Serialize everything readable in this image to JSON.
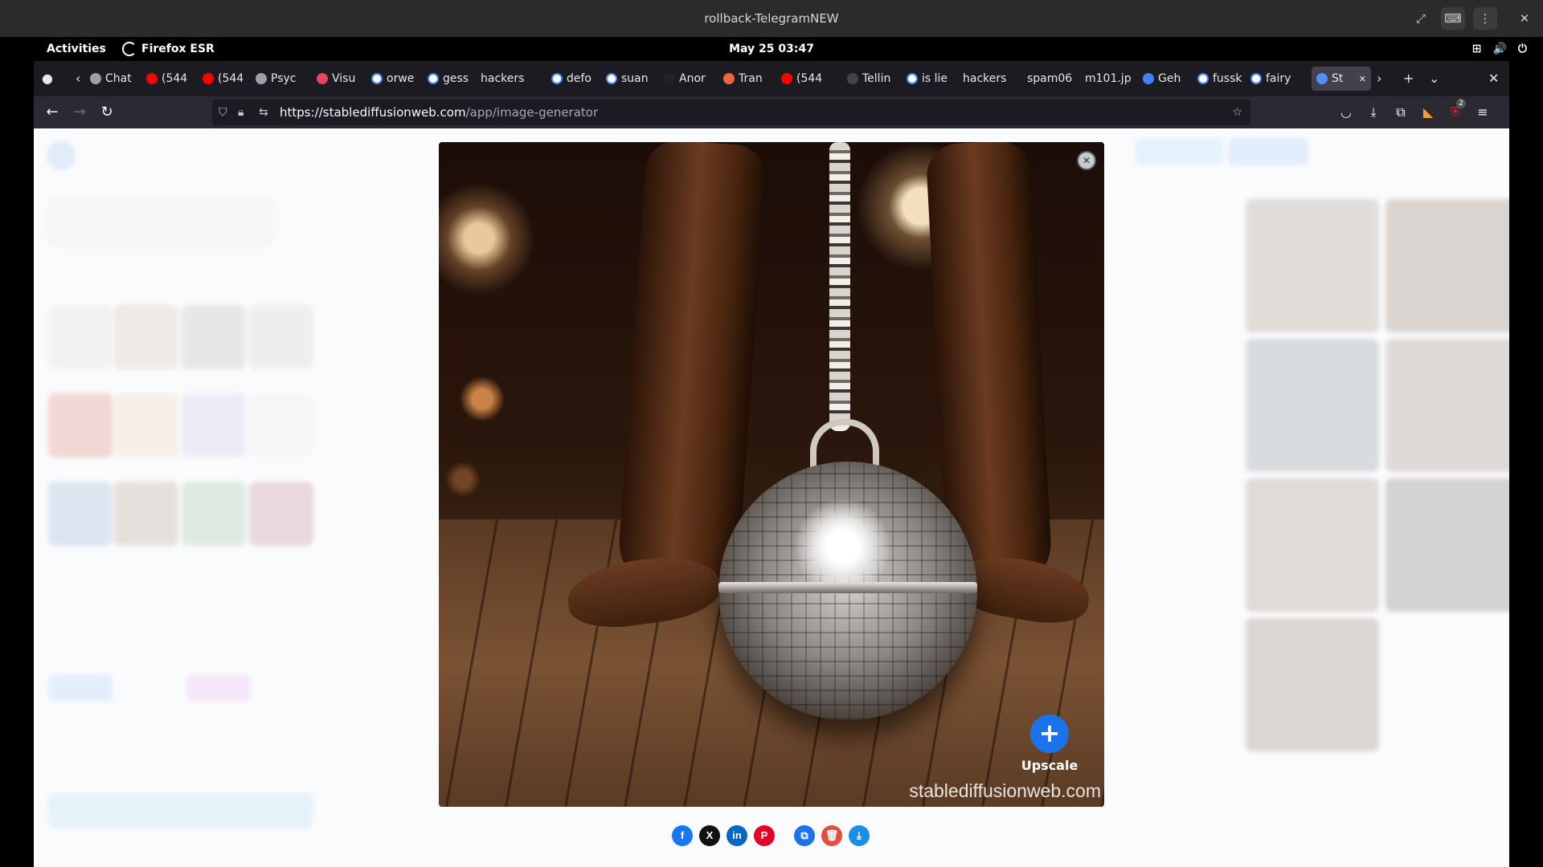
{
  "window": {
    "title": "rollback-TelegramNEW",
    "controls": [
      "expand-icon",
      "keyboard-icon",
      "menu-icon",
      "close-icon"
    ]
  },
  "topbar": {
    "activities": "Activities",
    "app_name": "Firefox ESR",
    "clock": "May 25  03:47"
  },
  "tabs": [
    {
      "label": "Chat",
      "icon": "chat-icon",
      "color": "#9aa0a6"
    },
    {
      "label": "(544",
      "icon": "youtube-icon",
      "color": "#ff0000"
    },
    {
      "label": "(544",
      "icon": "youtube-icon",
      "color": "#ff0000"
    },
    {
      "label": "Psyc",
      "icon": "chat-icon",
      "color": "#9aa0a6"
    },
    {
      "label": "Visu",
      "icon": "visual-icon",
      "color": "#e8455b"
    },
    {
      "label": "orwe",
      "icon": "google-icon",
      "color": "#ffffff"
    },
    {
      "label": "gess",
      "icon": "google-icon",
      "color": "#ffffff"
    },
    {
      "label": "hackers",
      "icon": "",
      "color": ""
    },
    {
      "label": "defo",
      "icon": "google-icon",
      "color": "#ffffff"
    },
    {
      "label": "suan",
      "icon": "google-icon",
      "color": "#ffffff"
    },
    {
      "label": "Anor",
      "icon": "github-icon",
      "color": "#222222"
    },
    {
      "label": "Tran",
      "icon": "translate-icon",
      "color": "#f0663c"
    },
    {
      "label": "(544",
      "icon": "youtube-icon",
      "color": "#ff0000"
    },
    {
      "label": "Tellin",
      "icon": "t-icon",
      "color": "#444444"
    },
    {
      "label": "is lie",
      "icon": "google-icon",
      "color": "#ffffff"
    },
    {
      "label": "hackers",
      "icon": "",
      "color": ""
    },
    {
      "label": "spam06",
      "icon": "",
      "color": ""
    },
    {
      "label": "m101.jp",
      "icon": "",
      "color": ""
    },
    {
      "label": "Geh",
      "icon": "bird-icon",
      "color": "#3d82f6"
    },
    {
      "label": "fussk",
      "icon": "google-icon",
      "color": "#ffffff"
    },
    {
      "label": "fairy",
      "icon": "google-icon",
      "color": "#ffffff"
    },
    {
      "label": "St",
      "icon": "stable-diffusion-icon",
      "color": "#4f8ff7",
      "active": true
    }
  ],
  "navbar": {
    "url_host": "https://stablediffusionweb.com",
    "url_path": "/app/image-generator",
    "extension_badge": "2"
  },
  "modal": {
    "upscale_label": "Upscale",
    "watermark": "stablediffusionweb.com",
    "share_buttons": [
      {
        "name": "facebook-share-button",
        "glyph": "f",
        "color": "#1877f2"
      },
      {
        "name": "x-share-button",
        "glyph": "X",
        "color": "#111111"
      },
      {
        "name": "linkedin-share-button",
        "glyph": "in",
        "color": "#0a66c2"
      },
      {
        "name": "pinterest-share-button",
        "glyph": "P",
        "color": "#e60023"
      },
      {
        "name": "copy-button",
        "glyph": "⧉",
        "color": "#1a73e8"
      },
      {
        "name": "delete-button",
        "glyph": "🗑",
        "color": "#e74c3c"
      },
      {
        "name": "download-button",
        "glyph": "⤓",
        "color": "#1a8fe8"
      }
    ]
  },
  "colors": {
    "accent": "#1a73e8",
    "browser_bg": "#1c1b22",
    "toolbar_bg": "#2b2a33"
  }
}
